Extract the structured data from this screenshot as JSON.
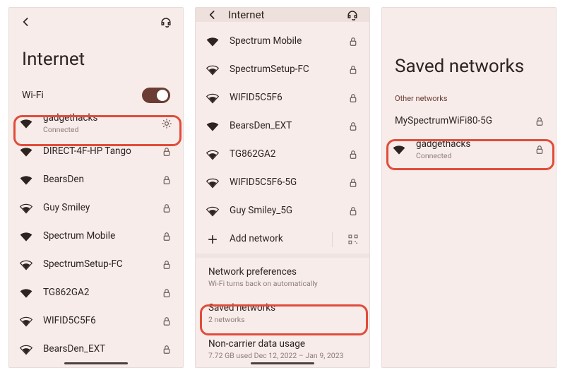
{
  "panel1": {
    "title": "Internet",
    "wifi_label": "Wi-Fi",
    "wifi_on": true,
    "networks": [
      {
        "name": "gadgethacks",
        "sub": "Connected",
        "trail": "gear",
        "signal": "full"
      },
      {
        "name": "DIRECT-4F-HP Tango",
        "trail": "lock",
        "signal": "full"
      },
      {
        "name": "BearsDen",
        "trail": "lock",
        "signal": "full"
      },
      {
        "name": "Guy Smiley",
        "trail": "lock",
        "signal": "mid"
      },
      {
        "name": "Spectrum Mobile",
        "trail": "lock",
        "signal": "full"
      },
      {
        "name": "SpectrumSetup-FC",
        "trail": "lock",
        "signal": "mid"
      },
      {
        "name": "TG862GA2",
        "trail": "lock",
        "signal": "full"
      },
      {
        "name": "WIFID5C5F6",
        "trail": "lock",
        "signal": "mid"
      },
      {
        "name": "BearsDen_EXT",
        "trail": "lock",
        "signal": "mid"
      }
    ]
  },
  "panel2": {
    "title": "Internet",
    "networks": [
      {
        "name": "Spectrum Mobile",
        "trail": "lock",
        "signal": "full"
      },
      {
        "name": "SpectrumSetup-FC",
        "trail": "lock",
        "signal": "mid"
      },
      {
        "name": "WIFID5C5F6",
        "trail": "lock",
        "signal": "mid"
      },
      {
        "name": "BearsDen_EXT",
        "trail": "lock",
        "signal": "full"
      },
      {
        "name": "TG862GA2",
        "trail": "lock",
        "signal": "mid"
      },
      {
        "name": "WIFID5C5F6-5G",
        "trail": "lock",
        "signal": "mid"
      },
      {
        "name": "Guy Smiley_5G",
        "trail": "lock",
        "signal": "mid"
      }
    ],
    "add_label": "Add network",
    "prefs": {
      "t": "Network preferences",
      "s": "Wi-Fi turns back on automatically"
    },
    "saved": {
      "t": "Saved networks",
      "s": "2 networks"
    },
    "usage": {
      "t": "Non-carrier data usage",
      "s": "7.72 GB used Dec 12, 2022 – Jan 9, 2023"
    }
  },
  "panel3": {
    "title": "Saved networks",
    "section": "Other networks",
    "items": [
      {
        "name": "MySpectrumWiFi80-5G",
        "trail": "lock",
        "wifi": false
      },
      {
        "name": "gadgethacks",
        "sub": "Connected",
        "trail": "lock",
        "wifi": true
      }
    ]
  }
}
